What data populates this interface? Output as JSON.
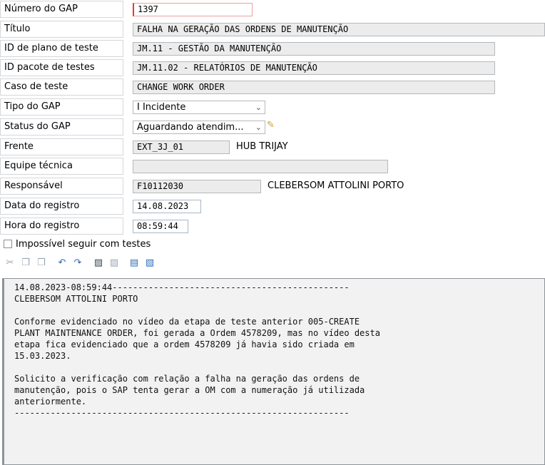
{
  "fields": {
    "numero_gap": {
      "label": "Número do GAP",
      "value": "1397"
    },
    "titulo": {
      "label": "Título",
      "value": "FALHA NA GERAÇÃO DAS ORDENS DE MANUTENÇÃO"
    },
    "id_plano": {
      "label": "ID de plano de teste",
      "value": "JM.11 - GESTÃO DA MANUTENÇÃO"
    },
    "id_pacote": {
      "label": "ID pacote de testes",
      "value": "JM.11.02 - RELATÓRIOS DE MANUTENÇÃO"
    },
    "caso_teste": {
      "label": "Caso de teste",
      "value": "CHANGE WORK ORDER"
    },
    "tipo_gap": {
      "label": "Tipo do GAP",
      "value": "I Incidente"
    },
    "status_gap": {
      "label": "Status do GAP",
      "value": "Aguardando atendim..."
    },
    "frente": {
      "label": "Frente",
      "value": "EXT_3J_01",
      "text": "HUB TRIJAY"
    },
    "equipe": {
      "label": "Equipe técnica",
      "value": ""
    },
    "responsavel": {
      "label": "Responsável",
      "value": "F10112030",
      "text": "CLEBERSOM ATTOLINI PORTO"
    },
    "data_registro": {
      "label": "Data do registro",
      "value": "14.08.2023"
    },
    "hora_registro": {
      "label": "Hora do registro",
      "value": "08:59:44"
    }
  },
  "checkbox": {
    "label": "Impossível seguir com testes",
    "checked": false
  },
  "toolbar": {
    "icons": [
      "cut-icon",
      "copy-icon",
      "paste-icon",
      "undo-icon",
      "redo-icon",
      "find-icon",
      "find-next-icon",
      "load-file-icon",
      "save-file-icon"
    ]
  },
  "editor": {
    "text": "14.08.2023-08:59:44----------------------------------------------\nCLEBERSOM ATTOLINI PORTO\n\nConforme evidenciado no vídeo da etapa de teste anterior 005-CREATE\nPLANT MAINTENANCE ORDER, foi gerada a Ordem 4578209, mas no vídeo desta\netapa fica evidenciado que a ordem 4578209 já havia sido criada em\n15.03.2023.\n\nSolicito a verificação com relação a falha na geração das ordens de\nmanutenção, pois o SAP tenta gerar a OM com a numeração já utilizada\nanteriormente.\n-----------------------------------------------------------------"
  }
}
